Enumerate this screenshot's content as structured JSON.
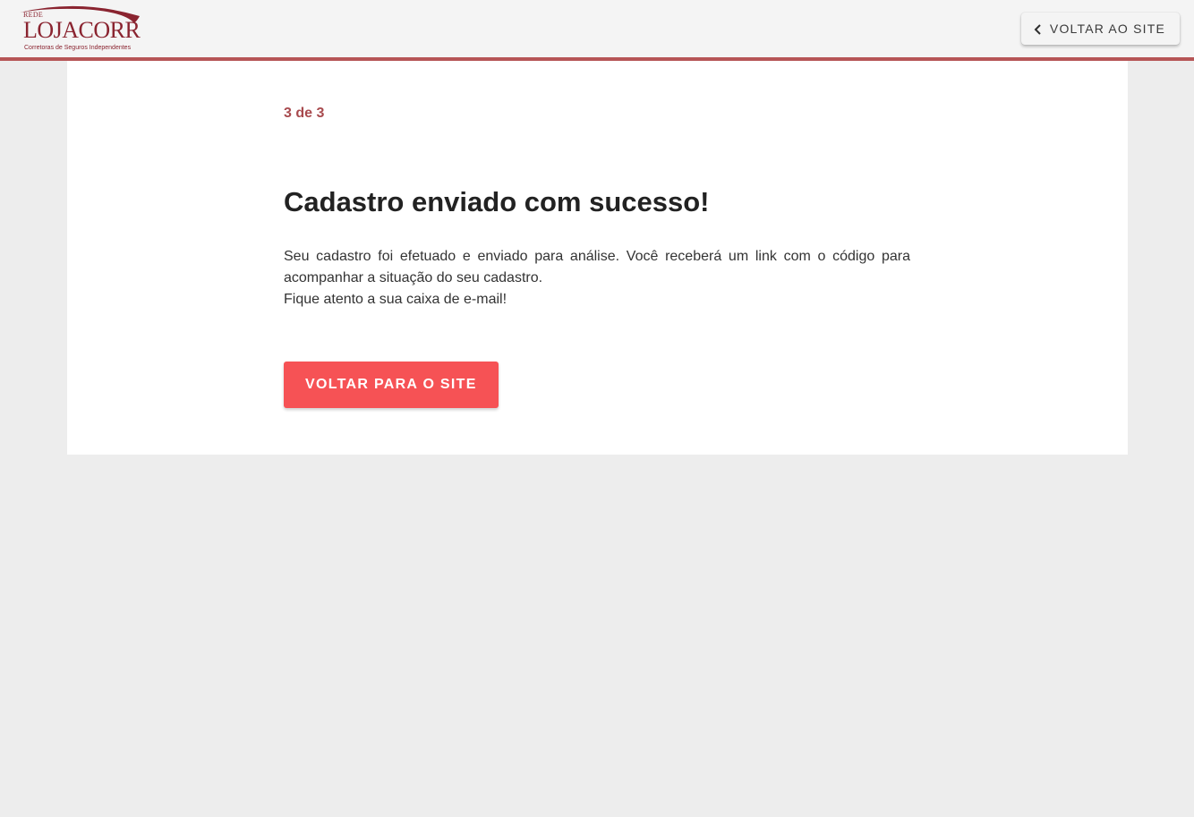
{
  "brand": {
    "prefix": "REDE",
    "name": "LOJACORR",
    "tagline": "Corretoras de Seguros Independentes",
    "color": "#8a2430"
  },
  "header": {
    "back_label": "VOLTAR AO SITE",
    "back_icon": "chevron-left-icon",
    "accent": "#b65556"
  },
  "main": {
    "step": "3 de 3",
    "title": "Cadastro enviado com sucesso!",
    "description_line1": "Seu cadastro foi efetuado e enviado para análise. Você receberá um link com o código para acompanhar a situação do seu cadastro.",
    "description_line2": "Fique atento a sua caixa de e-mail!",
    "cta_label": "VOLTAR PARA O SITE",
    "cta_color": "#f65255"
  }
}
